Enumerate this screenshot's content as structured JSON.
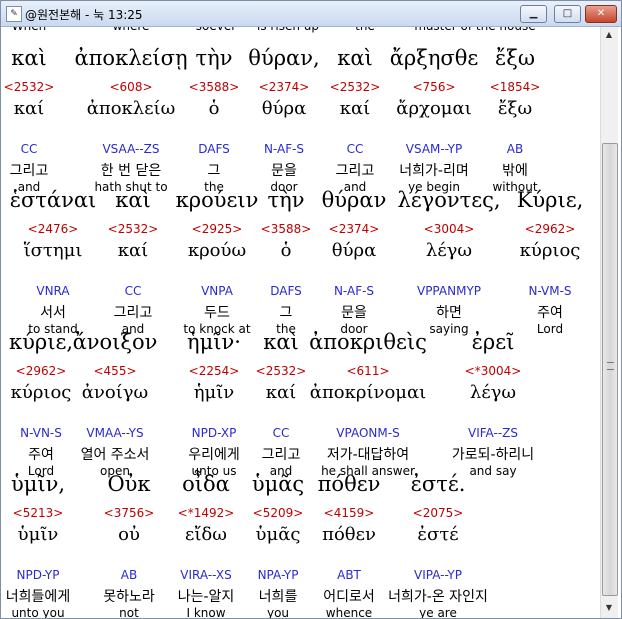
{
  "window": {
    "title": "@원전본해 - 눅 13:25"
  },
  "titlebar": {
    "minimize_glyph": "▁",
    "maximize_glyph": "□",
    "close_glyph": "✕"
  },
  "scrollbar": {
    "up_glyph": "▲",
    "down_glyph": "▼"
  },
  "cut_words": [
    "When",
    "where",
    "soever",
    "is risen up",
    "the",
    "master of the house"
  ],
  "rows": [
    {
      "words": [
        {
          "greek": "καὶ",
          "strong": "<2532>",
          "lemma": "καί",
          "parse": "CC",
          "korean": "그리고",
          "english": "and"
        },
        {
          "greek": "ἀποκλείσῃ",
          "strong": "<608>",
          "lemma": "ἀποκλείω",
          "parse": "VSAA--ZS",
          "korean": "한 번 닫은",
          "english": "hath shut to"
        },
        {
          "greek": "τὴν",
          "strong": "<3588>",
          "lemma": "ὁ",
          "parse": "DAFS",
          "korean": "그",
          "english": "the"
        },
        {
          "greek": "θύραν,",
          "strong": "<2374>",
          "lemma": "θύρα",
          "parse": "N-AF-S",
          "korean": "문을",
          "english": "door"
        },
        {
          "greek": "καὶ",
          "strong": "<2532>",
          "lemma": "καί",
          "parse": "CC",
          "korean": "그리고",
          "english": "and"
        },
        {
          "greek": "ἄρξησθε",
          "strong": "<756>",
          "lemma": "ἄρχομαι",
          "parse": "VSAM--YP",
          "korean": "너희가-리며",
          "english": "ye begin"
        },
        {
          "greek": "ἔξω",
          "strong": "<1854>",
          "lemma": "ἔξω",
          "parse": "AB",
          "korean": "밖에",
          "english": "without"
        }
      ]
    },
    {
      "words": [
        {
          "greek": "ἑστάναι",
          "strong": "<2476>",
          "lemma": "ἵστημι",
          "parse": "VNRA",
          "korean": "서서",
          "english": "to stand"
        },
        {
          "greek": "καὶ",
          "strong": "<2532>",
          "lemma": "καί",
          "parse": "CC",
          "korean": "그리고",
          "english": "and"
        },
        {
          "greek": "κρούειν",
          "strong": "<2925>",
          "lemma": "κρούω",
          "parse": "VNPA",
          "korean": "두드",
          "english": "to knock at"
        },
        {
          "greek": "τὴν",
          "strong": "<3588>",
          "lemma": "ὁ",
          "parse": "DAFS",
          "korean": "그",
          "english": "the"
        },
        {
          "greek": "θύραν",
          "strong": "<2374>",
          "lemma": "θύρα",
          "parse": "N-AF-S",
          "korean": "문을",
          "english": "door"
        },
        {
          "greek": "λέγοντες,",
          "strong": "<3004>",
          "lemma": "λέγω",
          "parse": "VPPANMYP",
          "korean": "하면",
          "english": "saying"
        },
        {
          "greek": "Κύριε,",
          "strong": "<2962>",
          "lemma": "κύριος",
          "parse": "N-VM-S",
          "korean": "주여",
          "english": "Lord"
        }
      ]
    },
    {
      "words": [
        {
          "greek": "κύριε,",
          "strong": "<2962>",
          "lemma": "κύριος",
          "parse": "N-VN-S",
          "korean": "주여",
          "english": "Lord"
        },
        {
          "greek": "ἄνοιξον",
          "strong": "<455>",
          "lemma": "ἀνοίγω",
          "parse": "VMAA--YS",
          "korean": "열어 주소서",
          "english": "open"
        },
        {
          "greek": "ἡμῖν·",
          "strong": "<2254>",
          "lemma": "ἡμῖν",
          "parse": "NPD-XP",
          "korean": "우리에게",
          "english": "unto us"
        },
        {
          "greek": "καὶ",
          "strong": "<2532>",
          "lemma": "καί",
          "parse": "CC",
          "korean": "그리고",
          "english": "and"
        },
        {
          "greek": "ἀποκριθεὶς",
          "strong": "<611>",
          "lemma": "ἀποκρίνομαι",
          "parse": "VPAONM-S",
          "korean": "저가-대답하여",
          "english": "he shall answer"
        },
        {
          "greek": "ἐρεῖ",
          "strong": "<*3004>",
          "lemma": "λέγω",
          "parse": "VIFA--ZS",
          "korean": "가로되-하리니",
          "english": "and say"
        }
      ]
    },
    {
      "words": [
        {
          "greek": "ὑμῖν,",
          "strong": "<5213>",
          "lemma": "ὑμῖν",
          "parse": "NPD-YP",
          "korean": "너희들에게",
          "english": "unto you"
        },
        {
          "greek": "Οὐκ",
          "strong": "<3756>",
          "lemma": "οὐ",
          "parse": "AB",
          "korean": "못하노라",
          "english": "not"
        },
        {
          "greek": "οἶδα",
          "strong": "<*1492>",
          "lemma": "εἴδω",
          "parse": "VIRA--XS",
          "korean": "나는-알지",
          "english": "I know"
        },
        {
          "greek": "ὑμᾶς",
          "strong": "<5209>",
          "lemma": "ὑμᾶς",
          "parse": "NPA-YP",
          "korean": "너희를",
          "english": "you"
        },
        {
          "greek": "πόθεν",
          "strong": "<4159>",
          "lemma": "πόθεν",
          "parse": "ABT",
          "korean": "어디로서",
          "english": "whence"
        },
        {
          "greek": "ἐστέ.",
          "strong": "<2075>",
          "lemma": "ἐστέ",
          "parse": "VIPA--YP",
          "korean": "너희가-온 자인지",
          "english": "ye are"
        }
      ]
    }
  ]
}
